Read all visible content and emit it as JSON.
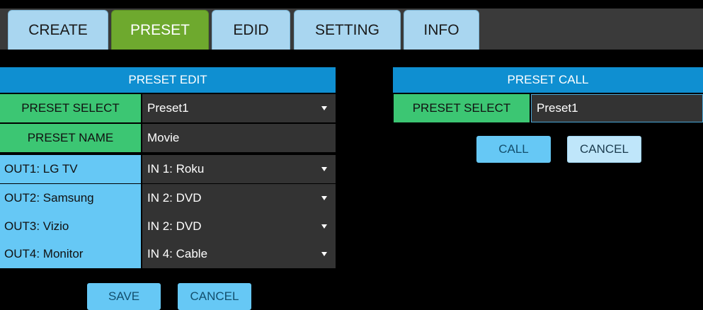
{
  "tabs": [
    {
      "label": "CREATE",
      "active": false
    },
    {
      "label": "PRESET",
      "active": true
    },
    {
      "label": "EDID",
      "active": false
    },
    {
      "label": "SETTING",
      "active": false
    },
    {
      "label": "INFO",
      "active": false
    }
  ],
  "preset_edit": {
    "title": "PRESET EDIT",
    "preset_select_label": "PRESET SELECT",
    "preset_select_value": "Preset1",
    "preset_name_label": "PRESET NAME",
    "preset_name_value": "Movie",
    "outputs": [
      {
        "label": "OUT1: LG TV",
        "value": "IN 1: Roku"
      },
      {
        "label": "OUT2: Samsung",
        "value": "IN 2: DVD"
      },
      {
        "label": "OUT3: Vizio",
        "value": "IN 2: DVD"
      },
      {
        "label": "OUT4: Monitor",
        "value": "IN 4: Cable"
      }
    ],
    "save_label": "SAVE",
    "cancel_label": "CANCEL"
  },
  "preset_call": {
    "title": "PRESET CALL",
    "preset_select_label": "PRESET SELECT",
    "preset_select_value": "Preset1",
    "call_label": "CALL",
    "cancel_label": "CANCEL"
  },
  "colors": {
    "active_tab": "#6ea92e",
    "tab": "#a9d6f0",
    "header": "#0f8fd1",
    "label_green": "#3cc673",
    "label_blue": "#66c8f5",
    "cell": "#333333"
  }
}
